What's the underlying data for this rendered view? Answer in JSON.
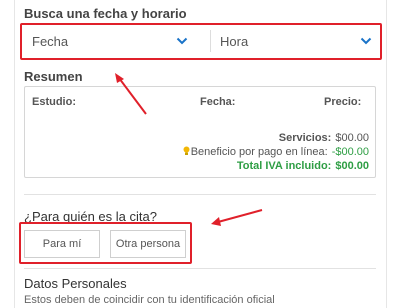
{
  "search": {
    "title": "Busca una fecha y horario",
    "date_value": "Fecha",
    "time_value": "Hora"
  },
  "summary": {
    "title": "Resumen",
    "col_study": "Estudio:",
    "col_date": "Fecha:",
    "col_price": "Precio:",
    "services_label": "Servicios:",
    "services_value": "$00.00",
    "benefit_label": "Beneficio por pago en línea:",
    "benefit_value": "-$00.00",
    "total_label": "Total IVA incluido:",
    "total_value": "$00.00"
  },
  "appointment": {
    "title": "¿Para quién es la cita?",
    "for_me": "Para mí",
    "other_person": "Otra persona"
  },
  "personal": {
    "title": "Datos Personales",
    "subtitle": "Estos deben de coincidir con tu identificación oficial"
  },
  "colors": {
    "highlight": "#e0202a",
    "chevron": "#1a73c8",
    "green": "#2e9e44",
    "bulb": "#f2b705"
  },
  "icons": {
    "dropdown": "chevron-down-icon",
    "benefit": "lightbulb-icon",
    "annotation": "arrow"
  }
}
